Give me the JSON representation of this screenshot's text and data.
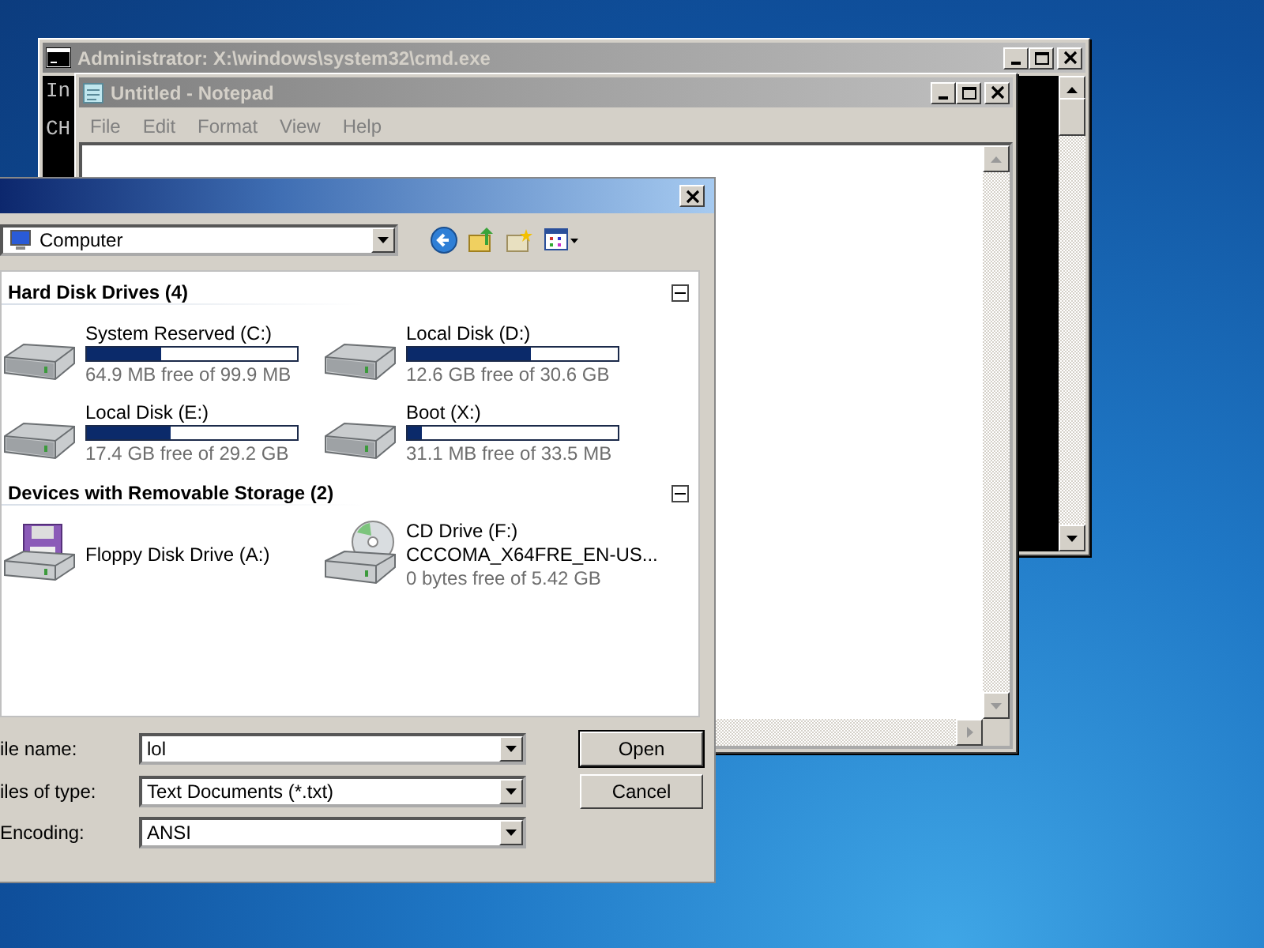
{
  "cmd_window": {
    "title": "Administrator: X:\\windows\\system32\\cmd.exe",
    "console_lines": [
      "In",
      "CH"
    ]
  },
  "notepad": {
    "title": "Untitled - Notepad",
    "menu": [
      "File",
      "Edit",
      "Format",
      "View",
      "Help"
    ]
  },
  "dialog": {
    "location": "Computer",
    "groups": [
      {
        "title": "Hard Disk Drives (4)",
        "items": [
          {
            "kind": "hdd",
            "name": "System Reserved (C:)",
            "level": 0.35,
            "reading": "64.9 MB free of 99.9 MB"
          },
          {
            "kind": "hdd",
            "name": "Local Disk (D:)",
            "level": 0.59,
            "reading": "12.6 GB free of 30.6 GB"
          },
          {
            "kind": "hdd",
            "name": "Local Disk (E:)",
            "level": 0.4,
            "reading": "17.4 GB free of 29.2 GB"
          },
          {
            "kind": "hdd",
            "name": "Boot (X:)",
            "level": 0.07,
            "reading": "31.1 MB free of 33.5 MB"
          }
        ]
      },
      {
        "title": "Devices with Removable Storage (2)",
        "items": [
          {
            "kind": "floppy",
            "name": "Floppy Disk Drive (A:)"
          },
          {
            "kind": "cd",
            "name": "CD Drive (F:)",
            "label": "CCCOMA_X64FRE_EN-US...",
            "reading": "0 bytes free of 5.42 GB"
          }
        ]
      }
    ],
    "fields": [
      {
        "label": "ile name:",
        "value": "lol"
      },
      {
        "label": "iles of type:",
        "value": "Text Documents (*.txt)"
      },
      {
        "label": "Encoding:",
        "value": "ANSI"
      }
    ],
    "buttons": [
      "Open",
      "Cancel"
    ]
  }
}
